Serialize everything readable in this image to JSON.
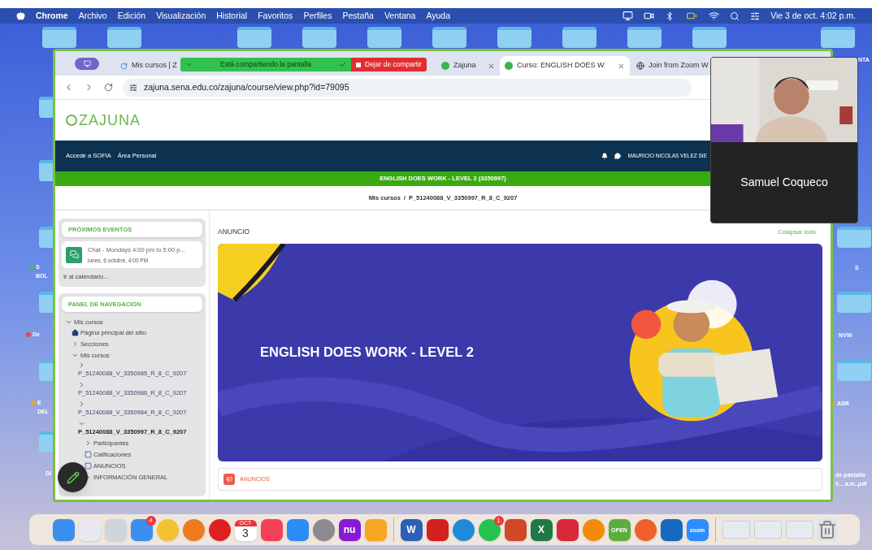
{
  "menu_bar": {
    "app": "Chrome",
    "menus": [
      "Archivo",
      "Edición",
      "Visualización",
      "Historial",
      "Favoritos",
      "Perfiles",
      "Pestaña",
      "Ventana",
      "Ayuda"
    ],
    "clock": "Vie 3 de oct. 4:02 p.m."
  },
  "desktop_labels": [
    {
      "text": "S",
      "color": "#3cc453"
    },
    {
      "text": "BOL"
    },
    {
      "text": "De",
      "color": "#e5484d"
    },
    {
      "text": "E",
      "color": "#f0a030"
    },
    {
      "text": "DEL"
    },
    {
      "text": "DI"
    },
    {
      "text": "NTA"
    },
    {
      "text": "S"
    },
    {
      "text": "NVW"
    },
    {
      "text": "ASR",
      "color": "#f0a030"
    },
    {
      "text": "de pantalla"
    },
    {
      "text": "0... a.m..pdf"
    }
  ],
  "browser": {
    "tabs": [
      {
        "title": "Mis cursos | Z",
        "selected": false,
        "kind": "loading"
      },
      {
        "title": "Zajuna",
        "selected": false,
        "kind": "site"
      },
      {
        "title": "Curso: ENGLISH DOES W",
        "selected": true,
        "kind": "site"
      },
      {
        "title": "Join from Zoom W",
        "selected": false,
        "kind": "globe"
      }
    ],
    "share_banner": {
      "status": "Está compartiendo la pantalla",
      "stop": "Dejar de compartir"
    },
    "url": "zajuna.sena.edu.co/zajuna/course/view.php?id=79095"
  },
  "site": {
    "logo": "ZAJUNA",
    "nav_links": [
      "Accede a SOFIA",
      "Área Personal"
    ],
    "user": "MAURICIO NICOLAS VELEZ SIE",
    "course_bar": "ENGLISH DOES WORK - LEVEL 2 (3350997)",
    "breadcrumb": [
      "Mis cursos",
      "P_51240088_V_3350997_R_8_C_9207"
    ],
    "breadcrumb_separator": "/",
    "events": {
      "title": "PRÓXIMOS EVENTOS",
      "items": [
        {
          "name": "Chat - Mondays 4:00 pm to 5:00 p...",
          "date": "lunes, 6 octubre, 4:00 PM"
        }
      ],
      "link": "Ir al calendario..."
    },
    "nav_panel": {
      "title": "PANEL DE NAVEGACIÓN",
      "tree": [
        {
          "label": "Mis cursos",
          "kind": "branch",
          "expanded": true,
          "selected": false,
          "children": [
            {
              "label": "Página principal del sitio",
              "kind": "home",
              "selected": false
            },
            {
              "label": "Secciones",
              "kind": "branch",
              "expanded": false,
              "selected": false
            },
            {
              "label": "Mis cursos",
              "kind": "branch",
              "expanded": true,
              "selected": false,
              "children": [
                {
                  "label": "P_51240088_V_3350985_R_8_C_9207",
                  "kind": "course",
                  "expanded": false,
                  "selected": false
                },
                {
                  "label": "P_51240088_V_3350986_R_8_C_9207",
                  "kind": "course",
                  "expanded": false,
                  "selected": false
                },
                {
                  "label": "P_51240088_V_3350984_R_8_C_9207",
                  "kind": "course",
                  "expanded": false,
                  "selected": false
                },
                {
                  "label": "P_51240088_V_3350997_R_8_C_9207",
                  "kind": "course",
                  "expanded": true,
                  "selected": true,
                  "children": [
                    {
                      "label": "Participantes",
                      "kind": "branch",
                      "expanded": false,
                      "selected": false
                    },
                    {
                      "label": "Calificaciones",
                      "kind": "leaf",
                      "selected": false
                    },
                    {
                      "label": "ANUNCIOS",
                      "kind": "leaf",
                      "selected": false
                    },
                    {
                      "label": "INFORMACIÓN GENERAL",
                      "kind": "branch",
                      "expanded": false,
                      "selected": false
                    }
                  ]
                }
              ]
            }
          ]
        }
      ]
    },
    "section_label": "ANUNCIO",
    "collapse_all": "Colapsar todo",
    "banner_title": "ENGLISH DOES WORK - LEVEL 2",
    "announcements": "ANUNCIOS"
  },
  "video": {
    "name": "Samuel Coqueco"
  },
  "dock": [
    {
      "kind": "app",
      "color": "#3b8ef0"
    },
    {
      "kind": "app",
      "color": "#e8e8ee"
    },
    {
      "kind": "app",
      "color": "#d0d4dc"
    },
    {
      "kind": "app",
      "color": "#3b8ef0",
      "badge": "4"
    },
    {
      "kind": "round",
      "color": "#f2c230"
    },
    {
      "kind": "round",
      "color": "#f07a20"
    },
    {
      "kind": "round",
      "color": "#e02020"
    },
    {
      "kind": "calendar",
      "color": "#ffffff",
      "text": "OCT",
      "day": "3"
    },
    {
      "kind": "app",
      "color": "#f5405a"
    },
    {
      "kind": "app",
      "color": "#2a8cf5"
    },
    {
      "kind": "round",
      "color": "#8a8a90"
    },
    {
      "kind": "app",
      "color": "#8a19d6",
      "text": "nu"
    },
    {
      "kind": "app",
      "color": "#f5a623"
    },
    {
      "kind": "separator"
    },
    {
      "kind": "app",
      "color": "#2b5fb8",
      "text": "W"
    },
    {
      "kind": "app",
      "color": "#d42020"
    },
    {
      "kind": "round",
      "color": "#1f8ad8"
    },
    {
      "kind": "round",
      "color": "#25c450",
      "badge": "1"
    },
    {
      "kind": "app",
      "color": "#d24726"
    },
    {
      "kind": "app",
      "color": "#1e7a45",
      "text": "X"
    },
    {
      "kind": "app",
      "color": "#d8283a"
    },
    {
      "kind": "round",
      "color": "#f58a0a"
    },
    {
      "kind": "app",
      "color": "#5cae3c",
      "text": "OPEN"
    },
    {
      "kind": "round",
      "color": "#f0602a"
    },
    {
      "kind": "app",
      "color": "#1668c0"
    },
    {
      "kind": "app",
      "color": "#2d8cff",
      "text": "zoom"
    },
    {
      "kind": "separator"
    },
    {
      "kind": "thumb",
      "color": "#e6eaf2"
    },
    {
      "kind": "thumb",
      "color": "#e6eaf2"
    },
    {
      "kind": "thumb",
      "color": "#e6eaf2"
    },
    {
      "kind": "trash",
      "color": "#dfe3e8"
    }
  ]
}
